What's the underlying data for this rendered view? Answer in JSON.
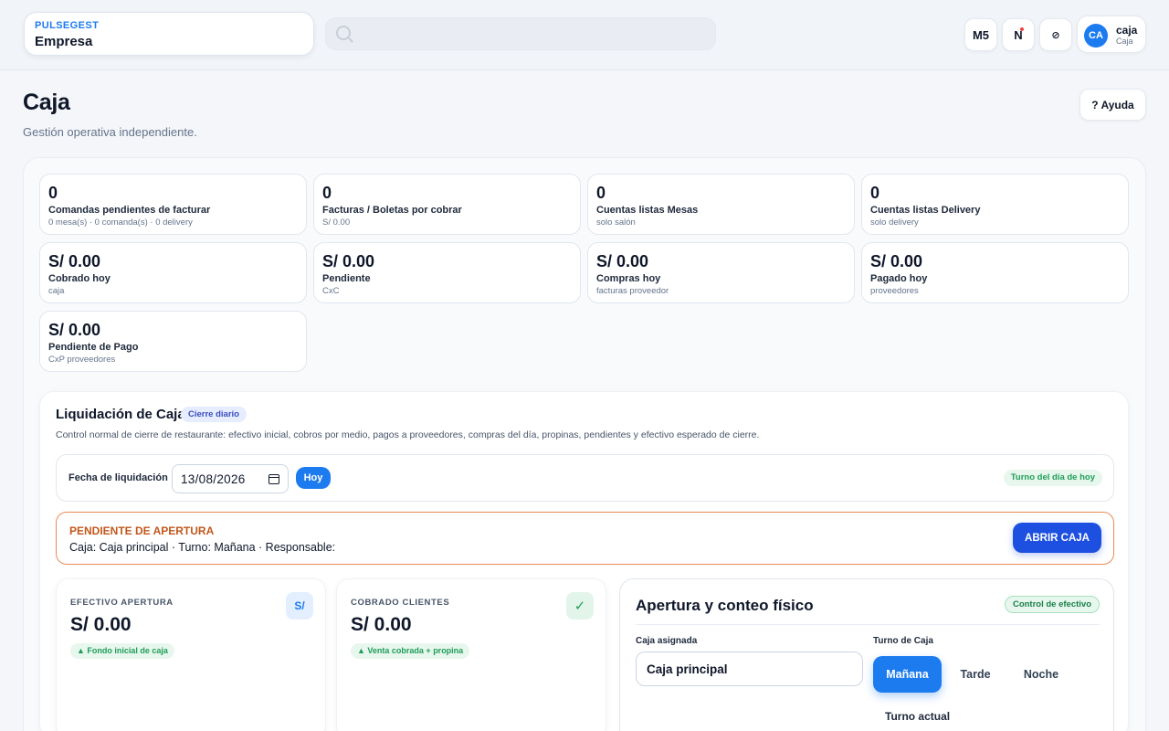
{
  "header": {
    "brand_small": "PULSEGEST",
    "brand_name": "Empresa",
    "search_placeholder": "",
    "btn_m5": "M5",
    "btn_n": "N",
    "btn_cfg": "⊘",
    "user": {
      "initials": "CA",
      "name": "caja",
      "role": "Caja"
    }
  },
  "page": {
    "title": "Caja",
    "subtitle": "Gestión operativa independiente.",
    "help_label": "? Ayuda"
  },
  "kpis": [
    {
      "value": "0",
      "label": "Comandas pendientes de facturar",
      "sub": "0 mesa(s) · 0 comanda(s) · 0 delivery"
    },
    {
      "value": "0",
      "label": "Facturas / Boletas por cobrar",
      "sub": "S/ 0.00"
    },
    {
      "value": "0",
      "label": "Cuentas listas Mesas",
      "sub": "solo salón"
    },
    {
      "value": "0",
      "label": "Cuentas listas Delivery",
      "sub": "solo delivery"
    },
    {
      "value": "S/ 0.00",
      "label": "Cobrado hoy",
      "sub": "caja"
    },
    {
      "value": "S/ 0.00",
      "label": "Pendiente",
      "sub": "CxC"
    },
    {
      "value": "S/ 0.00",
      "label": "Compras hoy",
      "sub": "facturas proveedor"
    },
    {
      "value": "S/ 0.00",
      "label": "Pagado hoy",
      "sub": "proveedores"
    },
    {
      "value": "S/ 0.00",
      "label": "Pendiente de Pago",
      "sub": "CxP proveedores"
    }
  ],
  "liquidacion": {
    "title": "Liquidación de Caja",
    "badge": "Cierre diario",
    "description": "Control normal de cierre de restaurante: efectivo inicial, cobros por medio, pagos a proveedores, compras del día, propinas, pendientes y efectivo esperado de cierre.",
    "date_label": "Fecha de liquidación",
    "date_value": "13/08/2026",
    "today_btn": "Hoy",
    "turno_pill": "Turno del día de hoy"
  },
  "pendiente": {
    "title": "PENDIENTE DE APERTURA",
    "detail": "Caja: Caja principal · Turno: Mañana · Responsable:",
    "action": "ABRIR CAJA"
  },
  "stats": [
    {
      "label": "EFECTIVO APERTURA",
      "value": "S/ 0.00",
      "chip": "▲ Fondo inicial de caja",
      "icon": "S/"
    },
    {
      "label": "COBRADO CLIENTES",
      "value": "S/ 0.00",
      "chip": "▲ Venta cobrada + propina",
      "icon": "✓"
    }
  ],
  "apertura": {
    "title": "Apertura y conteo físico",
    "badge": "Control de efectivo",
    "caja_label": "Caja asignada",
    "caja_value": "Caja principal",
    "turno_label": "Turno de Caja",
    "turnos": [
      "Mañana",
      "Tarde",
      "Noche"
    ],
    "turno_actual": "Turno actual"
  },
  "colors": {
    "accent": "#1d7bf0",
    "primary_button": "#1d4fe0",
    "warning": "#c2571b",
    "success": "#1f9d57"
  }
}
